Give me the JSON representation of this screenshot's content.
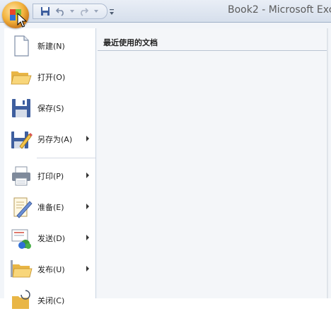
{
  "window": {
    "title": "Book2 - Microsoft Exce"
  },
  "menu": {
    "commands": [
      {
        "label": "新建(N)",
        "icon": "new-document-icon",
        "submenu": false
      },
      {
        "label": "打开(O)",
        "icon": "open-folder-icon",
        "submenu": false
      },
      {
        "label": "保存(S)",
        "icon": "save-disk-icon",
        "submenu": false
      },
      {
        "label": "另存为(A)",
        "icon": "save-as-icon",
        "submenu": true
      },
      {
        "label": "打印(P)",
        "icon": "printer-icon",
        "submenu": true
      },
      {
        "label": "准备(E)",
        "icon": "prepare-icon",
        "submenu": true
      },
      {
        "label": "发送(D)",
        "icon": "send-icon",
        "submenu": true
      },
      {
        "label": "发布(U)",
        "icon": "publish-icon",
        "submenu": true
      },
      {
        "label": "关闭(C)",
        "icon": "close-folder-icon",
        "submenu": false
      }
    ],
    "recent_title": "最近使用的文档"
  },
  "colors": {
    "accent": "#f3b33d",
    "panel": "#f2f5f9",
    "border": "#9fb1c8"
  }
}
